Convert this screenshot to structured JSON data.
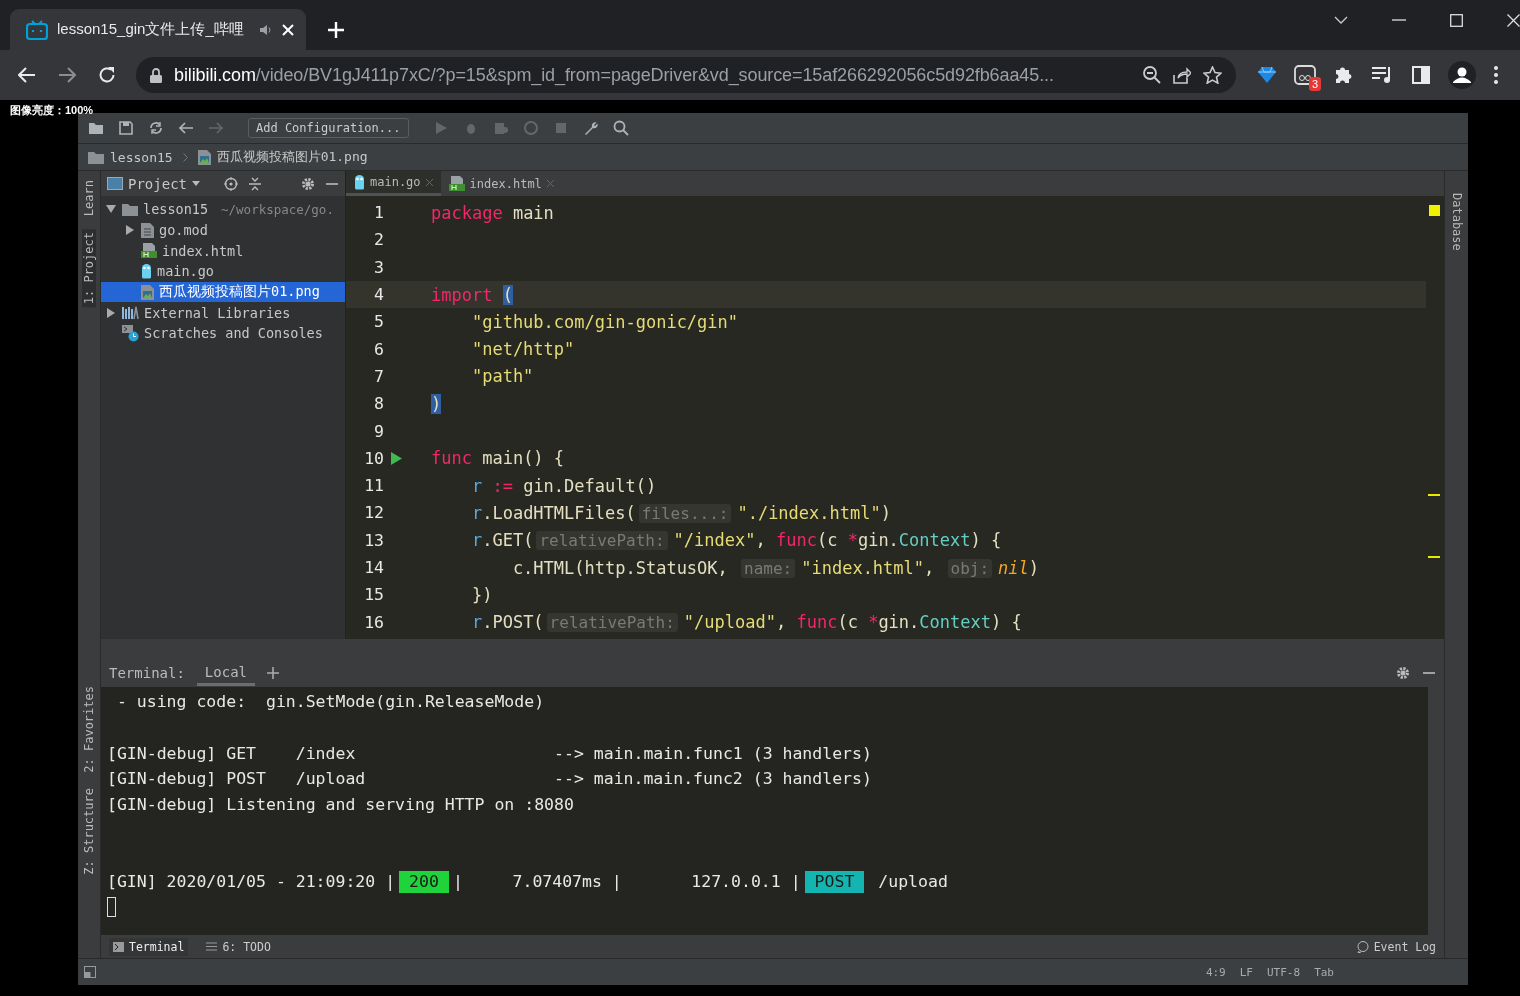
{
  "browser": {
    "tab": {
      "title": "lesson15_gin文件上传_哔哩",
      "selected": true
    },
    "address": {
      "domain": "bilibili.com",
      "path": "/video/BV1gJ411p7xC/?p=15&spm_id_from=pageDriver&vd_source=15af266292056c5d92fb6aa45..."
    },
    "extension_badge": "3",
    "overlay_text": "图像亮度：100%"
  },
  "ide": {
    "run_config": "Add Configuration...",
    "breadcrumb": [
      {
        "label": "lesson15",
        "kind": "folder"
      },
      {
        "label": "西瓜视频投稿图片01.png",
        "kind": "image"
      }
    ],
    "left_tool_tabs": [
      {
        "label": "Learn",
        "selected": false
      },
      {
        "label": "1: Project",
        "selected": true
      }
    ],
    "left_bottom_tabs": [
      {
        "label": "2: Favorites",
        "selected": false
      },
      {
        "label": "Z: Structure",
        "selected": false
      }
    ],
    "right_tool_tabs": [
      {
        "label": "Database",
        "selected": false
      }
    ],
    "project": {
      "title": "Project",
      "tree": [
        {
          "label": "lesson15",
          "kind": "folder",
          "hint": "~/workspace/go.",
          "expanded": true,
          "selected": false,
          "children": [
            {
              "label": "go.mod",
              "kind": "file",
              "expanded": false,
              "selected": false
            },
            {
              "label": "index.html",
              "kind": "html",
              "selected": false
            },
            {
              "label": "main.go",
              "kind": "go",
              "selected": false
            },
            {
              "label": "西瓜视频投稿图片01.png",
              "kind": "image",
              "selected": true
            }
          ]
        },
        {
          "label": "External Libraries",
          "kind": "library",
          "expanded": false,
          "selected": false
        },
        {
          "label": "Scratches and Consoles",
          "kind": "scratch",
          "selected": false
        }
      ]
    },
    "editor_tabs": [
      {
        "label": "main.go",
        "kind": "go",
        "selected": true
      },
      {
        "label": "index.html",
        "kind": "html",
        "selected": false
      }
    ],
    "code": [
      {
        "number": "1",
        "current": false,
        "run": false,
        "tokens": [
          {
            "text": "package",
            "kind": "keyword"
          },
          {
            "text": " main",
            "kind": "plain"
          }
        ]
      },
      {
        "number": "2",
        "current": false,
        "run": false
      },
      {
        "number": "3",
        "current": false,
        "run": false
      },
      {
        "number": "4",
        "current": true,
        "run": false,
        "tokens": [
          {
            "text": "import ",
            "kind": "keyword"
          },
          {
            "text": "(",
            "kind": "match"
          }
        ]
      },
      {
        "number": "5",
        "current": false,
        "run": false,
        "tokens": [
          {
            "text": "    \"github.com/gin-gonic/gin\"",
            "kind": "string"
          }
        ]
      },
      {
        "number": "6",
        "current": false,
        "run": false,
        "tokens": [
          {
            "text": "    \"net/http\"",
            "kind": "string"
          }
        ]
      },
      {
        "number": "7",
        "current": false,
        "run": false,
        "tokens": [
          {
            "text": "    \"path\"",
            "kind": "string"
          }
        ]
      },
      {
        "number": "8",
        "current": false,
        "run": false,
        "tokens": [
          {
            "text": ")",
            "kind": "match"
          }
        ]
      },
      {
        "number": "9",
        "current": false,
        "run": false
      },
      {
        "number": "10",
        "current": false,
        "run": true,
        "tokens": [
          {
            "text": "func",
            "kind": "keyword"
          },
          {
            "text": " main() {",
            "kind": "plain"
          }
        ]
      },
      {
        "number": "11",
        "current": false,
        "run": false,
        "tokens": [
          {
            "text": "    r",
            "kind": "variable"
          },
          {
            "text": " :=",
            "kind": "keyword"
          },
          {
            "text": " gin.Default()",
            "kind": "plain"
          }
        ]
      },
      {
        "number": "12",
        "current": false,
        "run": false,
        "tokens": [
          {
            "text": "    r",
            "kind": "variable"
          },
          {
            "text": ".LoadHTMLFiles(",
            "kind": "plain"
          },
          {
            "text": "files...:",
            "kind": "hint"
          },
          {
            "text": "\"./index.html\"",
            "kind": "string"
          },
          {
            "text": ")",
            "kind": "plain"
          }
        ]
      },
      {
        "number": "13",
        "current": false,
        "run": false,
        "tokens": [
          {
            "text": "    r",
            "kind": "variable"
          },
          {
            "text": ".GET(",
            "kind": "plain"
          },
          {
            "text": "relativePath:",
            "kind": "hint"
          },
          {
            "text": "\"/index\"",
            "kind": "string"
          },
          {
            "text": ", ",
            "kind": "plain"
          },
          {
            "text": "func",
            "kind": "keyword"
          },
          {
            "text": "(c ",
            "kind": "plain"
          },
          {
            "text": "*",
            "kind": "keyword"
          },
          {
            "text": "gin.",
            "kind": "plain"
          },
          {
            "text": "Context",
            "kind": "type"
          },
          {
            "text": ") {",
            "kind": "plain"
          }
        ]
      },
      {
        "number": "14",
        "current": false,
        "run": false,
        "tokens": [
          {
            "text": "        c.HTML(http.StatusOK, ",
            "kind": "plain"
          },
          {
            "text": "name:",
            "kind": "hint"
          },
          {
            "text": "\"index.html\"",
            "kind": "string"
          },
          {
            "text": ", ",
            "kind": "plain"
          },
          {
            "text": "obj:",
            "kind": "hint"
          },
          {
            "text": "nil",
            "kind": "constant"
          },
          {
            "text": ")",
            "kind": "plain"
          }
        ]
      },
      {
        "number": "15",
        "current": false,
        "run": false,
        "tokens": [
          {
            "text": "    })",
            "kind": "plain"
          }
        ]
      },
      {
        "number": "16",
        "current": false,
        "run": false,
        "tokens": [
          {
            "text": "    r",
            "kind": "variable"
          },
          {
            "text": ".POST(",
            "kind": "plain"
          },
          {
            "text": "relativePath:",
            "kind": "hint"
          },
          {
            "text": "\"/upload\"",
            "kind": "string"
          },
          {
            "text": ", ",
            "kind": "plain"
          },
          {
            "text": "func",
            "kind": "keyword"
          },
          {
            "text": "(c ",
            "kind": "plain"
          },
          {
            "text": "*",
            "kind": "keyword"
          },
          {
            "text": "gin.",
            "kind": "plain"
          },
          {
            "text": "Context",
            "kind": "type"
          },
          {
            "text": ") {",
            "kind": "plain"
          }
        ]
      }
    ],
    "terminal": {
      "title": "Terminal:",
      "tabs": [
        {
          "label": "Local",
          "selected": true
        }
      ],
      "lines": [
        {
          "kind": "text",
          "segments": [
            {
              "text": " - using code:  gin.SetMode(gin.ReleaseMode)"
            }
          ]
        },
        {
          "kind": "blank"
        },
        {
          "kind": "text",
          "segments": [
            {
              "text": "[GIN-debug] GET    /index                    --> main.main.func1 (3 handlers)"
            }
          ]
        },
        {
          "kind": "text",
          "segments": [
            {
              "text": "[GIN-debug] POST   /upload                   --> main.main.func2 (3 handlers)"
            }
          ]
        },
        {
          "kind": "text",
          "segments": [
            {
              "text": "[GIN-debug] Listening and serving HTTP on :8080"
            }
          ]
        },
        {
          "kind": "blank"
        },
        {
          "kind": "blank"
        },
        {
          "kind": "text",
          "segments": [
            {
              "text": "[GIN] 2020/01/05 - 21:09:20 |"
            },
            {
              "text": "200",
              "color": "#1fd43a"
            },
            {
              "text": "|     7.07407ms |       127.0.0.1 |"
            },
            {
              "text": "POST",
              "color": "#14b5b0"
            },
            {
              "text": " /upload"
            }
          ]
        },
        {
          "kind": "cursor"
        }
      ]
    },
    "bottom_tabs": [
      {
        "label": "Terminal",
        "selected": true
      },
      {
        "label": "6: TODO",
        "selected": false
      }
    ],
    "event_log": "Event Log",
    "status": [
      "4:9",
      "LF",
      "UTF-8",
      "Tab"
    ]
  }
}
